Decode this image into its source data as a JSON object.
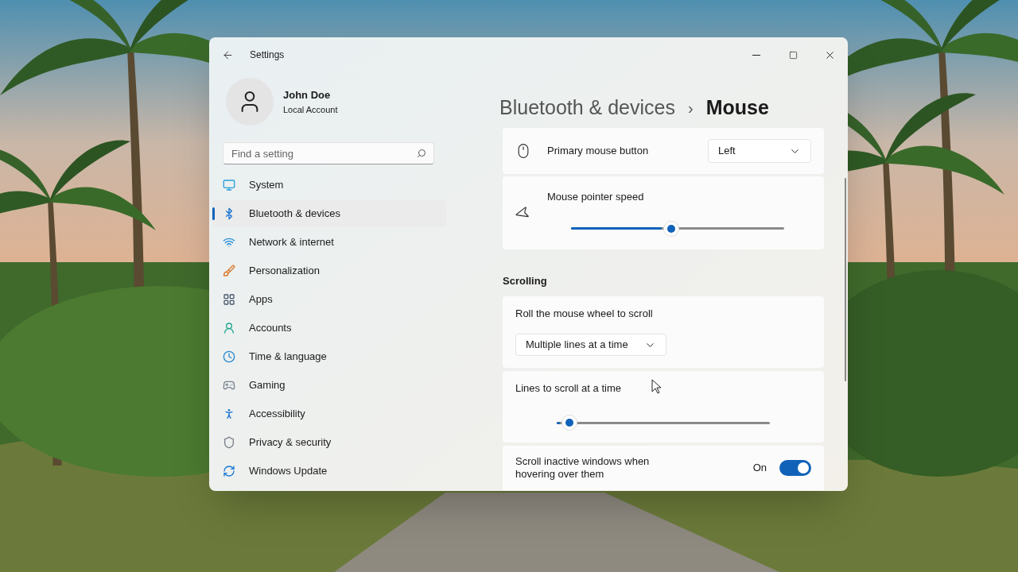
{
  "window": {
    "title": "Settings"
  },
  "account": {
    "name": "John Doe",
    "type": "Local Account"
  },
  "search": {
    "placeholder": "Find a setting"
  },
  "sidebar": {
    "items": [
      {
        "label": "System",
        "selected": false
      },
      {
        "label": "Bluetooth & devices",
        "selected": true
      },
      {
        "label": "Network & internet",
        "selected": false
      },
      {
        "label": "Personalization",
        "selected": false
      },
      {
        "label": "Apps",
        "selected": false
      },
      {
        "label": "Accounts",
        "selected": false
      },
      {
        "label": "Time & language",
        "selected": false
      },
      {
        "label": "Gaming",
        "selected": false
      },
      {
        "label": "Accessibility",
        "selected": false
      },
      {
        "label": "Privacy & security",
        "selected": false
      },
      {
        "label": "Windows Update",
        "selected": false
      }
    ]
  },
  "breadcrumb": {
    "parent": "Bluetooth & devices",
    "separator": "›",
    "current": "Mouse"
  },
  "mouse_settings": [
    {
      "kind": "dropdown",
      "label": "Primary mouse button",
      "value": "Left"
    },
    {
      "kind": "slider",
      "label": "Mouse pointer speed",
      "level": 0.47
    }
  ],
  "scrolling": {
    "heading": "Scrolling",
    "settings": [
      {
        "kind": "stacked_dropdown",
        "label": "Roll the mouse wheel to scroll",
        "value": "Multiple lines at a time"
      },
      {
        "kind": "stacked_slider",
        "label": "Lines to scroll at a time",
        "level": 0.06
      },
      {
        "kind": "toggle",
        "label": "Scroll inactive windows when hovering over them",
        "state_label": "On",
        "on": true
      }
    ]
  }
}
